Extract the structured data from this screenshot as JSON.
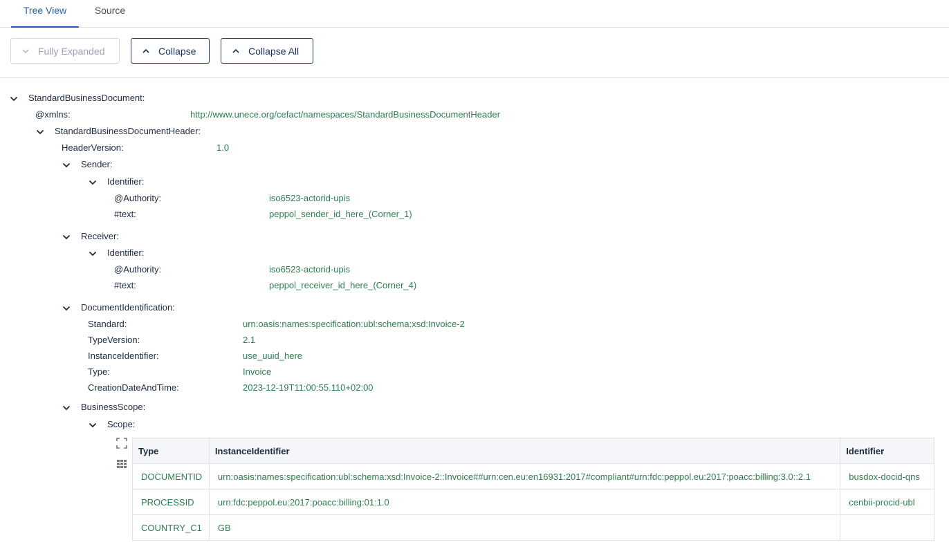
{
  "tabs": [
    {
      "label": "Tree View",
      "active": true
    },
    {
      "label": "Source",
      "active": false
    }
  ],
  "toolbar": {
    "fully_expanded": "Fully Expanded",
    "collapse": "Collapse",
    "collapse_all": "Collapse All"
  },
  "tree": {
    "root": "StandardBusinessDocument:",
    "xmlns_key": "@xmlns:",
    "xmlns_val": "http://www.unece.org/cefact/namespaces/StandardBusinessDocumentHeader",
    "header": "StandardBusinessDocumentHeader:",
    "header_version_key": "HeaderVersion:",
    "header_version_val": "1.0",
    "sender": {
      "label": "Sender:",
      "identifier": "Identifier:",
      "authority_key": "@Authority:",
      "authority_val": "iso6523-actorid-upis",
      "text_key": "#text:",
      "text_val": "peppol_sender_id_here_(Corner_1)"
    },
    "receiver": {
      "label": "Receiver:",
      "identifier": "Identifier:",
      "authority_key": "@Authority:",
      "authority_val": "iso6523-actorid-upis",
      "text_key": "#text:",
      "text_val": "peppol_receiver_id_here_(Corner_4)"
    },
    "doc_ident": {
      "label": "DocumentIdentification:",
      "standard_key": "Standard:",
      "standard_val": "urn:oasis:names:specification:ubl:schema:xsd:Invoice-2",
      "type_version_key": "TypeVersion:",
      "type_version_val": "2.1",
      "instance_key": "InstanceIdentifier:",
      "instance_val": "use_uuid_here",
      "type_key": "Type:",
      "type_val": "Invoice",
      "creation_key": "CreationDateAndTime:",
      "creation_val": "2023-12-19T11:00:55.110+02:00"
    },
    "business_scope": {
      "label": "BusinessScope:",
      "scope": "Scope:"
    }
  },
  "scope_table": {
    "headers": [
      "Type",
      "InstanceIdentifier",
      "Identifier"
    ],
    "rows": [
      [
        "DOCUMENTID",
        "urn:oasis:names:specification:ubl:schema:xsd:Invoice-2::Invoice##urn:cen.eu:en16931:2017#compliant#urn:fdc:peppol.eu:2017:poacc:billing:3.0::2.1",
        "busdox-docid-qns"
      ],
      [
        "PROCESSID",
        "urn:fdc:peppol.eu:2017:poacc:billing:01:1.0",
        "cenbii-procid-ubl"
      ],
      [
        "COUNTRY_C1",
        "GB",
        ""
      ]
    ]
  },
  "icons": {
    "chevron": "chevron-down-icon",
    "chevron_up": "chevron-up-icon",
    "fullscreen": "fullscreen-icon",
    "grid": "grid-icon"
  }
}
